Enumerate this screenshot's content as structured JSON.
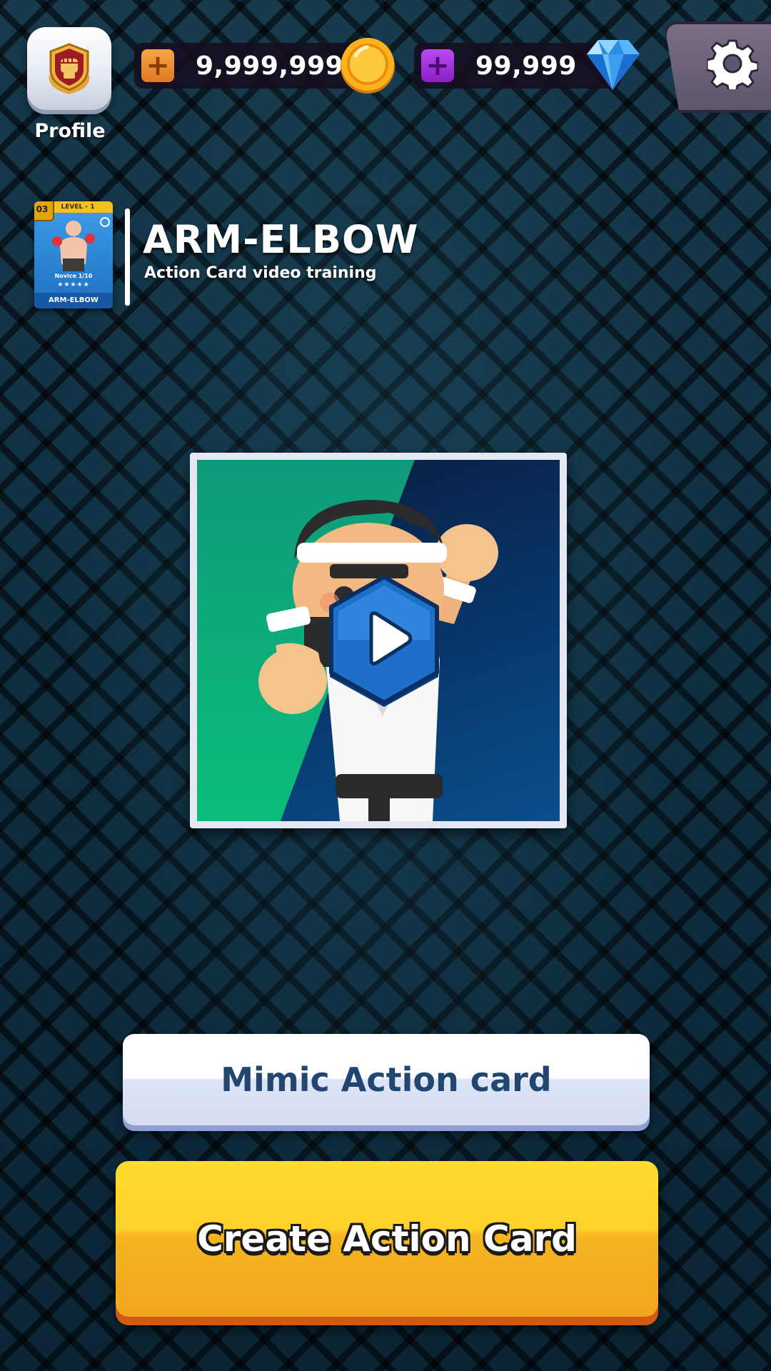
{
  "top_bar": {
    "profile_label": "Profile",
    "coins": {
      "amount": "9,999,999",
      "plus": "+",
      "icon": "gold-coin-icon",
      "color": "#f5a623"
    },
    "gems": {
      "amount": "99,999",
      "plus": "+",
      "icon": "blue-diamond-icon",
      "color": "#a22ee0"
    },
    "settings_icon": "gear-icon"
  },
  "card": {
    "rank": "03",
    "level": "LEVEL - 1",
    "tier": "Novice 1/10",
    "stars": "★★★★★",
    "name": "ARM-ELBOW"
  },
  "header": {
    "title": "ARM-ELBOW",
    "subtitle": "Action Card video training"
  },
  "video": {
    "play_icon": "play-icon"
  },
  "buttons": {
    "mimic": "Mimic Action card",
    "create": "Create Action Card"
  },
  "colors": {
    "accent_yellow": "#ffd12a",
    "button_blue_text": "#224670",
    "play_blue": "#1565c0"
  }
}
